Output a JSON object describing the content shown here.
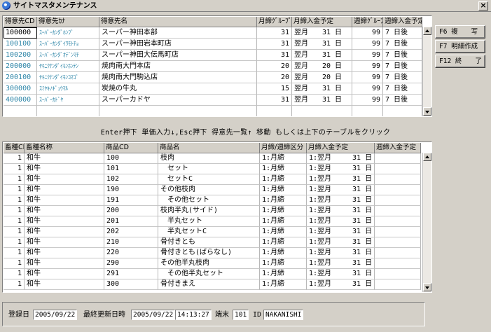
{
  "window": {
    "title": "サイトマスタメンテナンス",
    "close_label": "×"
  },
  "customer_table": {
    "headers": [
      "得意先CD",
      "得意先ｶﾅ",
      "得意先名",
      "月締ｸﾞﾙｰﾌﾟ",
      "月締入金予定",
      "週締ｸﾞﾙｰﾌﾟ",
      "週締入金予定"
    ],
    "rows": [
      [
        "100000",
        "ｽｰﾊﾟｰｶﾝﾀﾞﾎﾝﾌﾞ",
        "スーパー神田本部",
        "31",
        "翌月　　31 日",
        "99",
        "7 日後"
      ],
      [
        "100100",
        "ｽｰﾊﾟｰｶﾝﾀﾞｲﾜﾓﾄﾁｮ",
        "スーパー神田岩本町店",
        "31",
        "翌月　　31 日",
        "99",
        "7 日後"
      ],
      [
        "100200",
        "ｽｰﾊﾟｰｶﾝﾀﾞｵﾃﾞﾝﾏﾁ",
        "スーパー神田大伝馬町店",
        "31",
        "翌月　　31 日",
        "99",
        "7 日後"
      ],
      [
        "200000",
        "ﾔｷﾆｸﾅﾝﾀﾞｲﾓﾝﾎﾝﾃﾝ",
        "焼肉南大門本店",
        "20",
        "翌月　　20 日",
        "99",
        "7 日後"
      ],
      [
        "200100",
        "ﾔｷﾆｸﾅﾝﾀﾞｲﾓﾝｺﾏｺﾞ",
        "焼肉南大門駒込店",
        "20",
        "翌月　　20 日",
        "99",
        "7 日後"
      ],
      [
        "300000",
        "ｽﾐﾔｷﾉｷﾞｭｳﾏﾙ",
        "炭焼の牛丸",
        "15",
        "翌月　　31 日",
        "99",
        "7 日後"
      ],
      [
        "400000",
        "ｽｰﾊﾟｰｶﾄﾞﾔ",
        "スーパーカドヤ",
        "31",
        "翌月　　31 日",
        "99",
        "7 日後"
      ]
    ]
  },
  "function_buttons": {
    "f6": "F6 複　　写",
    "f7": "F7 明細作成",
    "f12": "F12 終　　了"
  },
  "hint_text": "Enter押下  単価入力↓,Esc押下  得意先一覧↑  移動    もしくは上下のテーブルをクリック",
  "product_table": {
    "headers": [
      "畜種CD",
      "畜種名称",
      "商品CD",
      "商品名",
      "月締/週締区分",
      "月締入金予定",
      "週締入金予定"
    ],
    "rows": [
      [
        "1",
        "和牛",
        "100",
        "枝肉",
        "1:月締",
        "1:翌月　　　31 日",
        ""
      ],
      [
        "1",
        "和牛",
        "101",
        "　セット",
        "1:月締",
        "1:翌月　　　31 日",
        ""
      ],
      [
        "1",
        "和牛",
        "102",
        "　セットC",
        "1:月締",
        "1:翌月　　　31 日",
        ""
      ],
      [
        "1",
        "和牛",
        "190",
        "その他枝肉",
        "1:月締",
        "1:翌月　　　31 日",
        ""
      ],
      [
        "1",
        "和牛",
        "191",
        "　その他セット",
        "1:月締",
        "1:翌月　　　31 日",
        ""
      ],
      [
        "1",
        "和牛",
        "200",
        "枝肉半丸(サイド)",
        "1:月締",
        "1:翌月　　　31 日",
        ""
      ],
      [
        "1",
        "和牛",
        "201",
        "　半丸セット",
        "1:月締",
        "1:翌月　　　31 日",
        ""
      ],
      [
        "1",
        "和牛",
        "202",
        "　半丸セットC",
        "1:月締",
        "1:翌月　　　31 日",
        ""
      ],
      [
        "1",
        "和牛",
        "210",
        "骨付きとも",
        "1:月締",
        "1:翌月　　　31 日",
        ""
      ],
      [
        "1",
        "和牛",
        "220",
        "骨付きとも(ばらなし)",
        "1:月締",
        "1:翌月　　　31 日",
        ""
      ],
      [
        "1",
        "和牛",
        "290",
        "その他半丸枝肉",
        "1:月締",
        "1:翌月　　　31 日",
        ""
      ],
      [
        "1",
        "和牛",
        "291",
        "　その他半丸セット",
        "1:月締",
        "1:翌月　　　31 日",
        ""
      ],
      [
        "1",
        "和牛",
        "300",
        "骨付きまえ",
        "1:月締",
        "1:翌月　　　31 日",
        ""
      ]
    ]
  },
  "status": {
    "registered_label": "登録日",
    "registered_value": "2005/09/22",
    "updated_label": "最終更新日時",
    "updated_date": "2005/09/22",
    "updated_time": "14:13:27",
    "terminal_label": "端末",
    "terminal_value": "101",
    "id_label": "ID",
    "id_value": "NAKANISHI"
  }
}
